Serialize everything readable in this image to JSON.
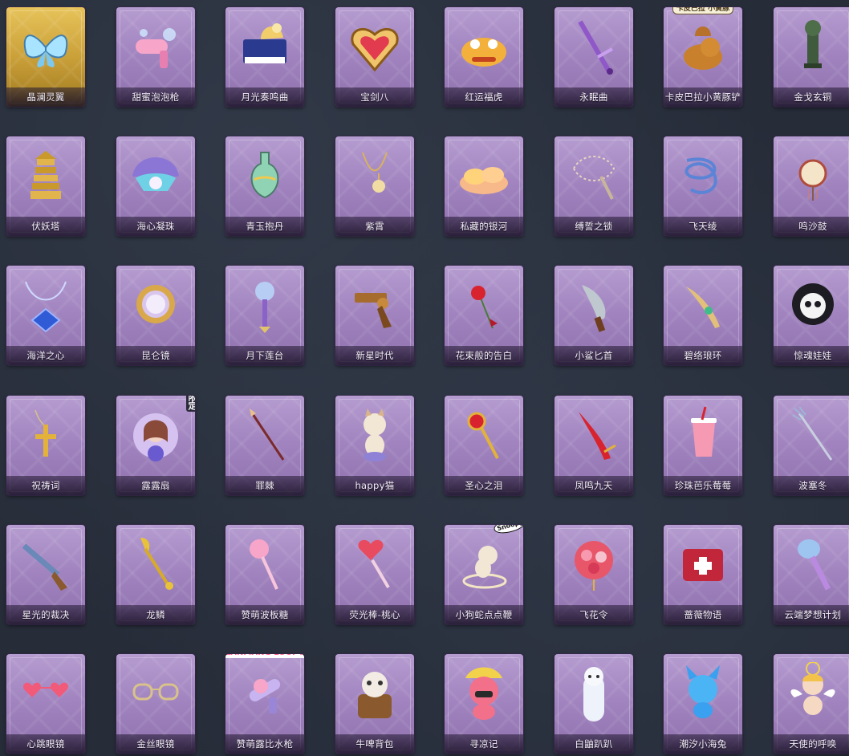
{
  "colors": {
    "background": "#262c38",
    "card_purple": "#a285c0",
    "card_gold": "#caa039",
    "label_text": "#f4eefa"
  },
  "items": [
    {
      "label": "晶澜灵翼",
      "icon": "crystal-wings-icon",
      "rarity": "gold"
    },
    {
      "label": "甜蜜泡泡枪",
      "icon": "bubble-gun-icon",
      "rarity": "purple"
    },
    {
      "label": "月光奏鸣曲",
      "icon": "piano-icon",
      "rarity": "purple"
    },
    {
      "label": "宝剑八",
      "icon": "heart-shield-icon",
      "rarity": "purple"
    },
    {
      "label": "红运福虎",
      "icon": "tiger-icon",
      "rarity": "purple"
    },
    {
      "label": "永眠曲",
      "icon": "sword-icon",
      "rarity": "purple"
    },
    {
      "label": "卡皮巴拉小黄豚铲",
      "icon": "capybara-icon",
      "rarity": "purple",
      "badge": "卡皮巴拉 小黄豚",
      "badge_type": "collab"
    },
    {
      "label": "金戈玄铜",
      "icon": "bronze-weapon-icon",
      "rarity": "purple"
    },
    {
      "label": "伏妖塔",
      "icon": "pagoda-icon",
      "rarity": "purple"
    },
    {
      "label": "海心凝珠",
      "icon": "shell-pearl-icon",
      "rarity": "purple"
    },
    {
      "label": "青玉抱丹",
      "icon": "jade-vase-icon",
      "rarity": "purple"
    },
    {
      "label": "紫霄",
      "icon": "pendant-icon",
      "rarity": "purple"
    },
    {
      "label": "私藏的银河",
      "icon": "cloud-icon",
      "rarity": "purple"
    },
    {
      "label": "缚誓之锁",
      "icon": "chain-icon",
      "rarity": "purple"
    },
    {
      "label": "飞天绫",
      "icon": "ribbon-icon",
      "rarity": "purple"
    },
    {
      "label": "鸣沙鼓",
      "icon": "drum-icon",
      "rarity": "purple"
    },
    {
      "label": "海洋之心",
      "icon": "necklace-icon",
      "rarity": "purple"
    },
    {
      "label": "昆仑镜",
      "icon": "mirror-icon",
      "rarity": "purple"
    },
    {
      "label": "月下莲台",
      "icon": "lotus-scepter-icon",
      "rarity": "purple"
    },
    {
      "label": "新星时代",
      "icon": "revolver-icon",
      "rarity": "purple"
    },
    {
      "label": "花束般的告白",
      "icon": "rose-icon",
      "rarity": "purple"
    },
    {
      "label": "小鲨匕首",
      "icon": "shark-dagger-icon",
      "rarity": "purple"
    },
    {
      "label": "碧络琅环",
      "icon": "jade-blade-icon",
      "rarity": "purple"
    },
    {
      "label": "惊魂娃娃",
      "icon": "skull-doll-icon",
      "rarity": "purple"
    },
    {
      "label": "祝祷词",
      "icon": "cross-icon",
      "rarity": "purple"
    },
    {
      "label": "露露扇",
      "icon": "fan-girl-icon",
      "rarity": "purple",
      "badge": "限定",
      "badge_type": "limited"
    },
    {
      "label": "罪棘",
      "icon": "spear-icon",
      "rarity": "purple"
    },
    {
      "label": "happy猫",
      "icon": "cat-icon",
      "rarity": "purple"
    },
    {
      "label": "圣心之泪",
      "icon": "ruby-scepter-icon",
      "rarity": "purple"
    },
    {
      "label": "凤鸣九天",
      "icon": "red-blade-icon",
      "rarity": "purple"
    },
    {
      "label": "珍珠芭乐莓莓",
      "icon": "drink-cup-icon",
      "rarity": "purple"
    },
    {
      "label": "波塞冬",
      "icon": "trident-icon",
      "rarity": "purple"
    },
    {
      "label": "星光的裁决",
      "icon": "shotgun-icon",
      "rarity": "purple"
    },
    {
      "label": "龙鳞",
      "icon": "golden-shovel-icon",
      "rarity": "purple"
    },
    {
      "label": "赞萌波板糖",
      "icon": "lollipop-icon",
      "rarity": "purple"
    },
    {
      "label": "荧光棒-桃心",
      "icon": "heart-wand-icon",
      "rarity": "purple"
    },
    {
      "label": "小狗蛇点点鞭",
      "icon": "dog-whip-icon",
      "rarity": "purple",
      "badge": "Snoopy",
      "badge_type": "snoopy"
    },
    {
      "label": "飞花令",
      "icon": "flower-lantern-icon",
      "rarity": "purple"
    },
    {
      "label": "蔷薇物语",
      "icon": "medkit-icon",
      "rarity": "purple"
    },
    {
      "label": "云端梦想计划",
      "icon": "dream-club-icon",
      "rarity": "purple"
    },
    {
      "label": "心跳眼镜",
      "icon": "heart-glasses-icon",
      "rarity": "purple"
    },
    {
      "label": "金丝眼镜",
      "icon": "glasses-icon",
      "rarity": "purple"
    },
    {
      "label": "赞萌露比水枪",
      "icon": "water-gun-icon",
      "rarity": "purple",
      "badge": "ZANMANG LOOPY",
      "badge_type": "loopy"
    },
    {
      "label": "牛啤背包",
      "icon": "cow-barrel-icon",
      "rarity": "purple"
    },
    {
      "label": "寻凉记",
      "icon": "pink-beaver-icon",
      "rarity": "purple"
    },
    {
      "label": "白鼬趴趴",
      "icon": "ermine-icon",
      "rarity": "purple"
    },
    {
      "label": "潮汐小海兔",
      "icon": "blue-bunny-icon",
      "rarity": "purple"
    },
    {
      "label": "天使的呼唤",
      "icon": "cherub-icon",
      "rarity": "purple"
    }
  ]
}
